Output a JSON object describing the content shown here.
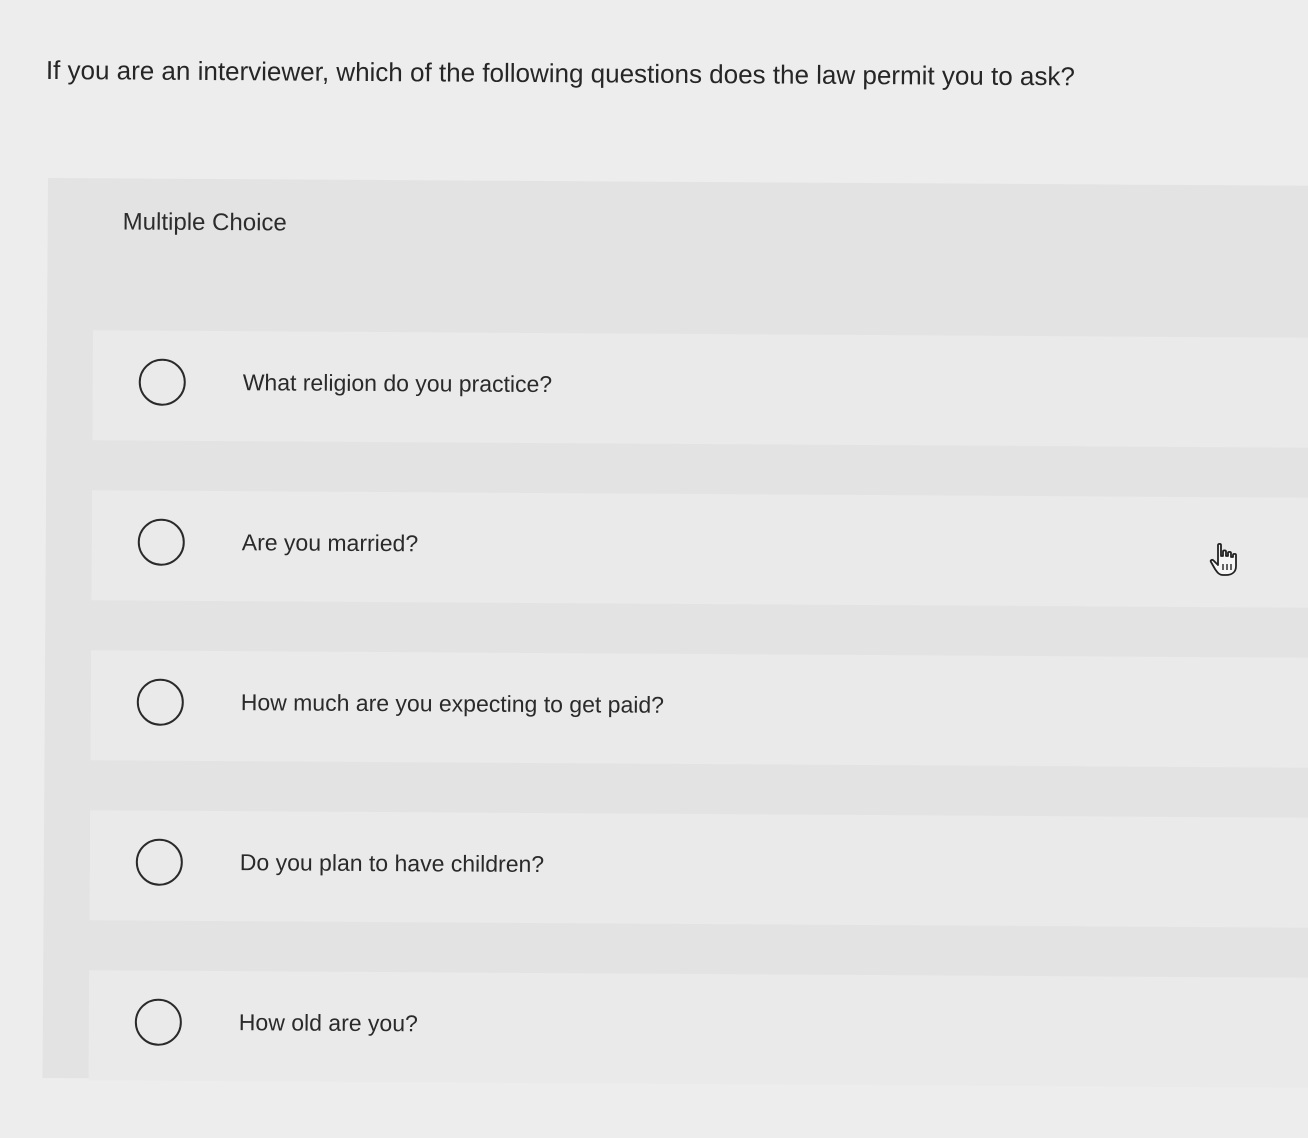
{
  "question": {
    "text": "If you are an interviewer, which of the following questions does the law permit you to ask?"
  },
  "multiple_choice": {
    "label": "Multiple Choice",
    "options": [
      {
        "label": "What religion do you practice?",
        "selected": false
      },
      {
        "label": "Are you married?",
        "selected": false
      },
      {
        "label": "How much are you expecting to get paid?",
        "selected": false
      },
      {
        "label": "Do you plan to have children?",
        "selected": false
      },
      {
        "label": "How old are you?",
        "selected": false
      }
    ]
  },
  "cursor": {
    "icon": "hand-pointer-icon"
  },
  "colors": {
    "page_bg": "#ededed",
    "panel_bg": "#e3e3e3",
    "option_bg": "#eaeaea",
    "text": "#2a2a2a"
  }
}
